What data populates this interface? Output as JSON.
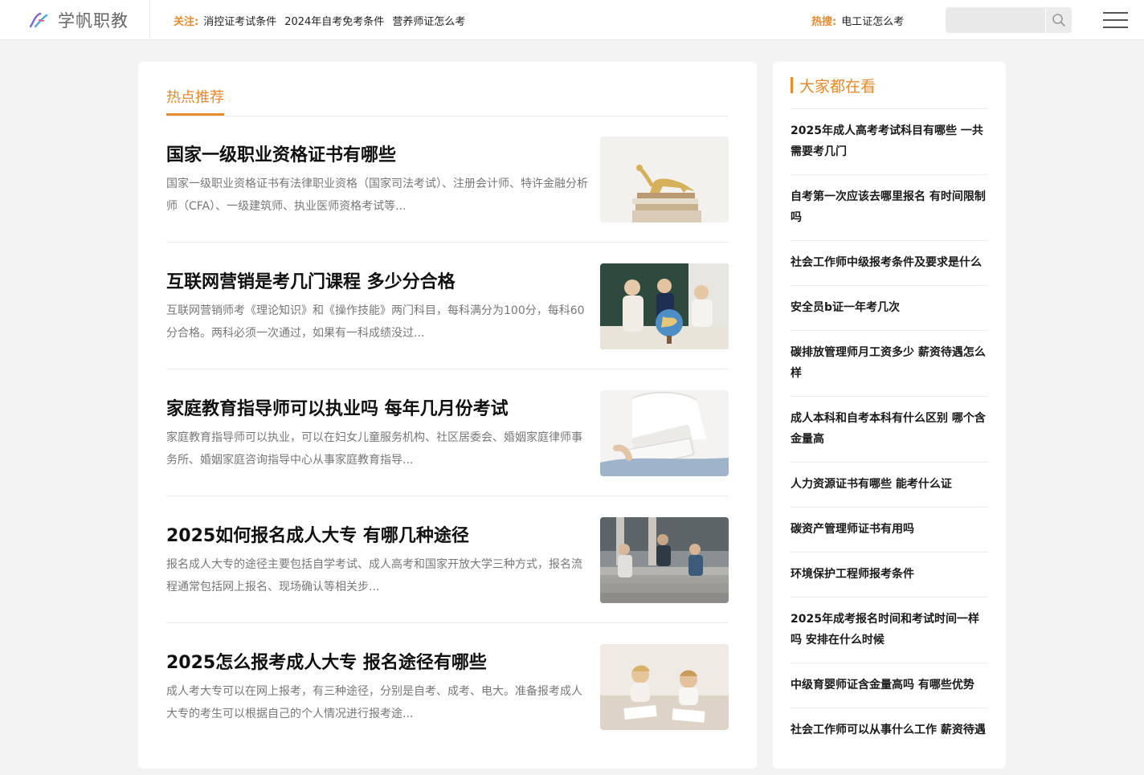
{
  "header": {
    "logo_text": "学帆职教",
    "follow_label": "关注:",
    "follow_links": [
      "消控证考试条件",
      "2024年自考免考条件",
      "营养师证怎么考"
    ],
    "hot_label": "热搜:",
    "hot_link": "电工证怎么考",
    "search_placeholder": ""
  },
  "main": {
    "section_tab": "热点推荐",
    "articles": [
      {
        "title": "国家一级职业资格证书有哪些",
        "summary": "国家一级职业资格证书有法律职业资格（国家司法考试）、注册会计师、特许金融分析师（CFA）、一级建筑师、执业医师资格考试等...",
        "thumb": "dinosaur-books-photo"
      },
      {
        "title": "互联网营销是考几门课程 多少分合格",
        "summary": "互联网营销师考《理论知识》和《操作技能》两门科目，每科满分为100分，每科60分合格。两科必须一次通过，如果有一科成绩没过...",
        "thumb": "classroom-globe-photo"
      },
      {
        "title": "家庭教育指导师可以执业吗 每年几月份考试",
        "summary": "家庭教育指导师可以执业，可以在妇女儿童服务机构、社区居委会、婚姻家庭律师事务所、婚姻家庭咨询指导中心从事家庭教育指导...",
        "thumb": "reading-woman-photo"
      },
      {
        "title": "2025如何报名成人大专 有哪几种途径",
        "summary": "报名成人大专的途径主要包括自学考试、成人高考和国家开放大学三种方式，报名流程通常包括网上报名、现场确认等相关步...",
        "thumb": "students-stairs-photo"
      },
      {
        "title": "2025怎么报考成人大专 报名途径有哪些",
        "summary": "成人考大专可以在网上报考，有三种途径，分别是自考、成考、电大。准备报考成人大专的考生可以根据自己的个人情况进行报考途...",
        "thumb": "kids-drawing-photo"
      }
    ]
  },
  "sidebar": {
    "title": "大家都在看",
    "items": [
      "2025年成人高考考试科目有哪些 一共需要考几门",
      "自考第一次应该去哪里报名 有时间限制吗",
      "社会工作师中级报考条件及要求是什么",
      "安全员b证一年考几次",
      "碳排放管理师月工资多少 薪资待遇怎么样",
      "成人本科和自考本科有什么区别 哪个含金量高",
      "人力资源证书有哪些 能考什么证",
      "碳资产管理师证书有用吗",
      "环境保护工程师报考条件",
      "2025年成考报名时间和考试时间一样吗 安排在什么时候",
      "中级育婴师证含金量高吗 有哪些优势",
      "社会工作师可以从事什么工作 薪资待遇"
    ]
  },
  "colors": {
    "accent": "#e68a2e",
    "title": "#111111",
    "summary": "#777777"
  }
}
